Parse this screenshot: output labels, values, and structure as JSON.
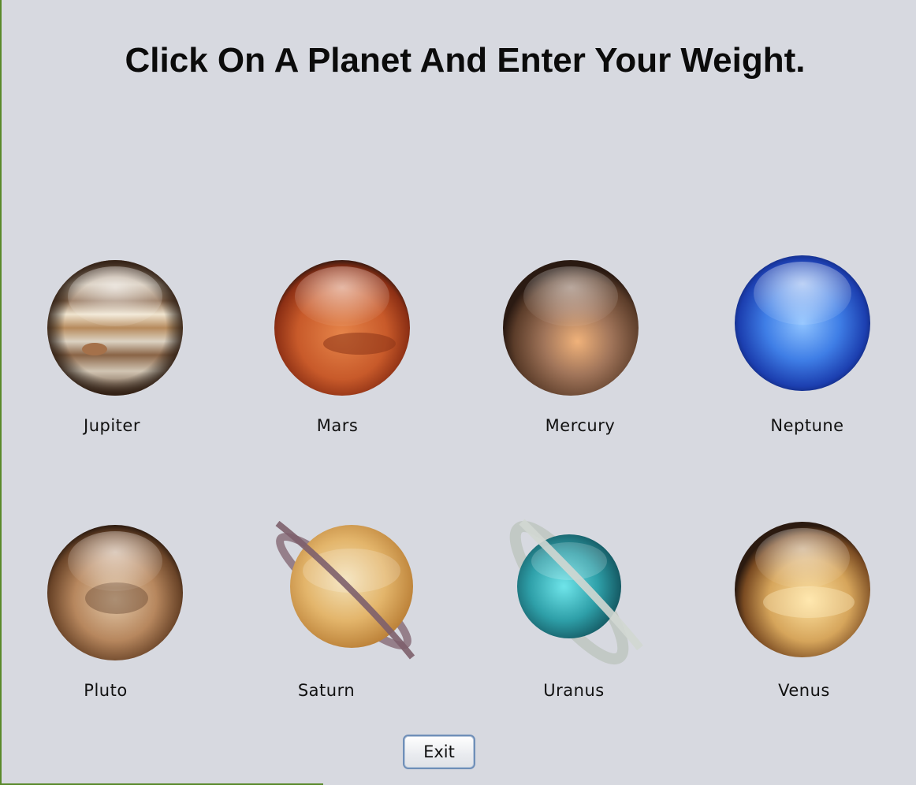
{
  "title": "Click On A Planet And Enter Your Weight.",
  "planets": [
    {
      "label": "Jupiter",
      "icon": "jupiter-icon"
    },
    {
      "label": "Mars",
      "icon": "mars-icon"
    },
    {
      "label": "Mercury",
      "icon": "mercury-icon"
    },
    {
      "label": "Neptune",
      "icon": "neptune-icon"
    },
    {
      "label": "Pluto",
      "icon": "pluto-icon"
    },
    {
      "label": "Saturn",
      "icon": "saturn-icon"
    },
    {
      "label": "Uranus",
      "icon": "uranus-icon"
    },
    {
      "label": "Venus",
      "icon": "venus-icon"
    }
  ],
  "exit_label": "Exit",
  "colors": {
    "background": "#d7d9e0",
    "title_text": "#0b0b0b",
    "button_border": "#6f8fb8"
  }
}
